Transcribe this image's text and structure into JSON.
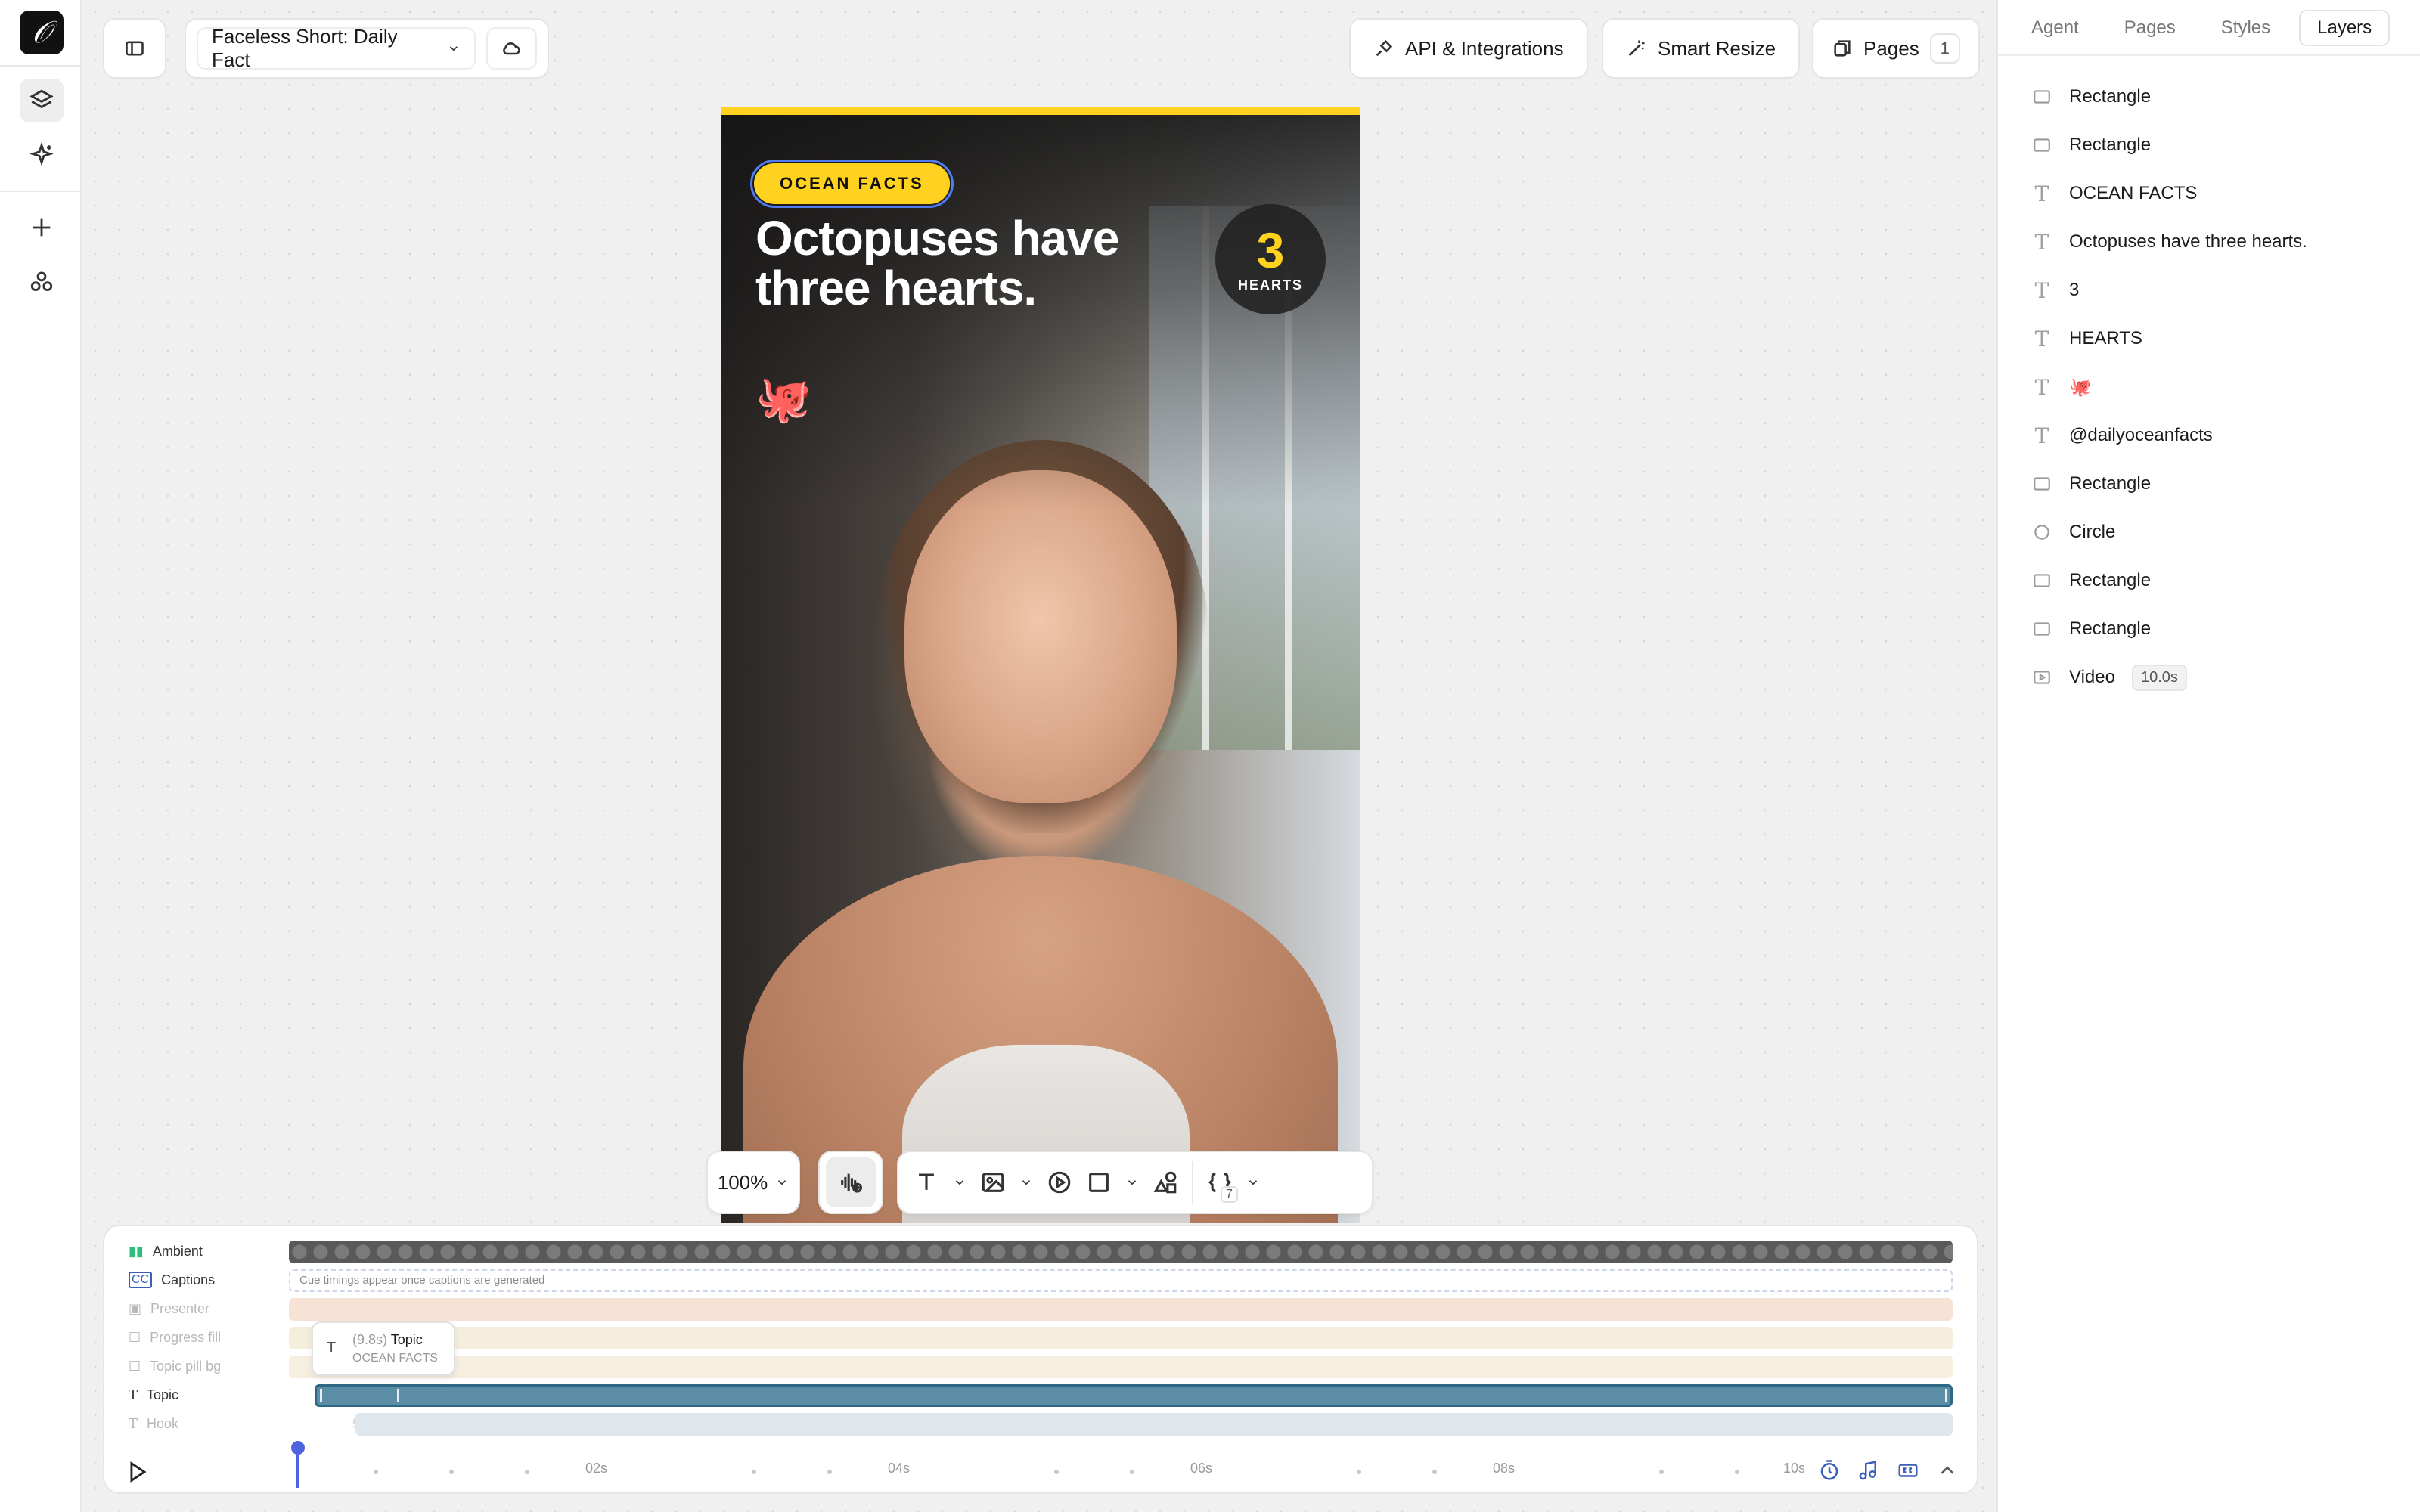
{
  "project": {
    "title": "Faceless Short: Daily Fact"
  },
  "header": {
    "api_label": "API & Integrations",
    "resize_label": "Smart Resize",
    "pages_label": "Pages",
    "pages_count": "1"
  },
  "artboard": {
    "topic_pill": "OCEAN FACTS",
    "headline": "Octopuses have three hearts.",
    "stat_number": "3",
    "stat_label": "HEARTS",
    "emoji": "🐙"
  },
  "canvas_toolbar": {
    "zoom": "100%",
    "variables_count": "7"
  },
  "timeline": {
    "tracks": [
      {
        "name": "Ambient",
        "duration": "10s"
      },
      {
        "name": "Captions",
        "duration": ""
      },
      {
        "name": "Presenter",
        "duration": "10s"
      },
      {
        "name": "Progress fill",
        "duration": "10s"
      },
      {
        "name": "Topic pill bg",
        "duration": "9.9s"
      },
      {
        "name": "Topic",
        "duration": "9.9s"
      },
      {
        "name": "Hook",
        "duration": "9.6s"
      }
    ],
    "captions_placeholder": "Cue timings appear once captions are generated",
    "tooltip": {
      "duration": "(9.8s)",
      "name": "Topic",
      "value": "OCEAN FACTS"
    },
    "ruler": [
      "02s",
      "04s",
      "06s",
      "08s",
      "10s"
    ]
  },
  "panel": {
    "tabs": [
      "Agent",
      "Pages",
      "Styles",
      "Layers"
    ],
    "active_tab": "Layers",
    "layers": [
      {
        "icon": "rect",
        "name": "Rectangle"
      },
      {
        "icon": "rect",
        "name": "Rectangle"
      },
      {
        "icon": "text",
        "name": "OCEAN FACTS"
      },
      {
        "icon": "text",
        "name": "Octopuses have three hearts."
      },
      {
        "icon": "text",
        "name": "3"
      },
      {
        "icon": "text",
        "name": "HEARTS"
      },
      {
        "icon": "text",
        "name": "🐙"
      },
      {
        "icon": "text",
        "name": "@dailyoceanfacts"
      },
      {
        "icon": "rect",
        "name": "Rectangle"
      },
      {
        "icon": "circle",
        "name": "Circle"
      },
      {
        "icon": "rect",
        "name": "Rectangle"
      },
      {
        "icon": "rect",
        "name": "Rectangle"
      },
      {
        "icon": "video",
        "name": "Video",
        "badge": "10.0s"
      }
    ]
  },
  "colors": {
    "accent_yellow": "#ffd21f",
    "selection_blue": "#4f7cf0",
    "topic_track": "#5b8da6",
    "playhead": "#4f63e0"
  }
}
